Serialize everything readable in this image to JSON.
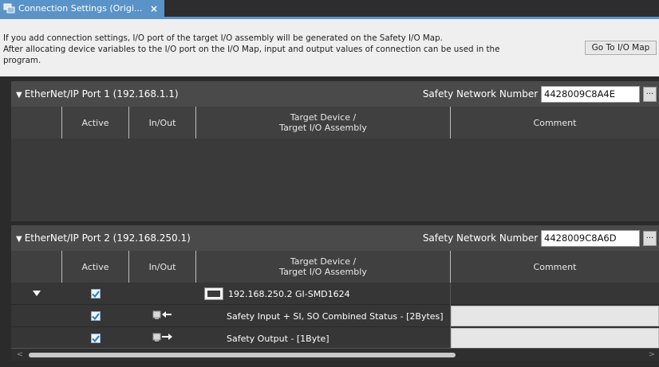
{
  "tab": {
    "label": "Connection Settings (Origi...",
    "close": "×"
  },
  "info": {
    "line1": "If you add connection settings, I/O port of the target I/O assembly will be generated on the Safety I/O Map.",
    "line2": "After allocating device variables to the I/O port on the I/O Map, input and output values of connection can be used in the",
    "line3": "program.",
    "goto_button": "Go To I/O Map"
  },
  "columns": {
    "active": "Active",
    "inout": "In/Out",
    "target_line1": "Target Device /",
    "target_line2": "Target I/O Assembly",
    "comment": "Comment"
  },
  "panels": [
    {
      "title": "EtherNet/IP Port 1 (192.168.1.1)",
      "snn_label": "Safety Network Number :",
      "snn_value": "4428009C8A4E",
      "snn_button": "..."
    },
    {
      "title": "EtherNet/IP Port 2 (192.168.250.1)",
      "snn_label": "Safety Network Number :",
      "snn_value": "4428009C8A6D",
      "snn_button": "...",
      "rows": [
        {
          "target": "192.168.250.2 GI-SMD1624",
          "active": true
        },
        {
          "target": "Safety Input + SI, SO Combined Status - [2Bytes]",
          "active": true,
          "direction": "in"
        },
        {
          "target": "Safety Output - [1Byte]",
          "active": true,
          "direction": "out"
        }
      ]
    }
  ],
  "scrollbar": {
    "left_arrow": "<",
    "right_arrow": ">"
  },
  "colors": {
    "tab_accent": "#5a93c8",
    "panel_bg": "#333333",
    "header_bg": "#4a4a4a"
  }
}
